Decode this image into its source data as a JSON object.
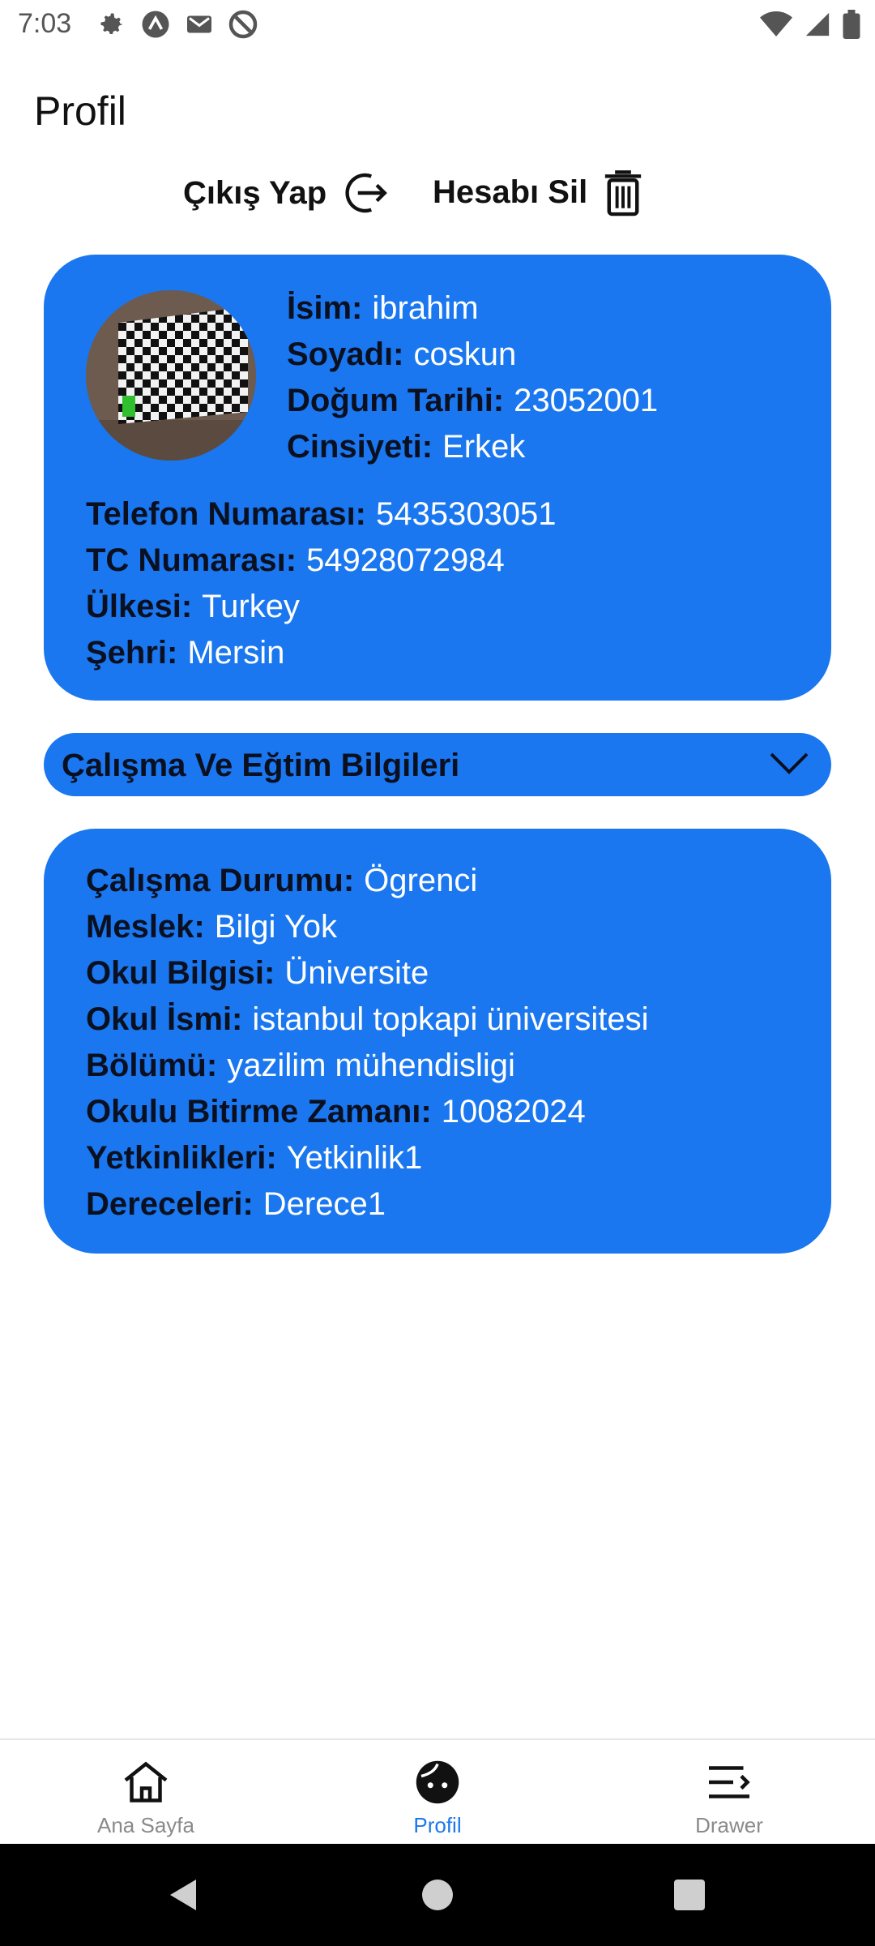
{
  "status_bar": {
    "time": "7:03",
    "icons_left": [
      "gear-icon",
      "app-icon",
      "gmail-icon",
      "nodisturb-icon"
    ],
    "icons_right": [
      "wifi-icon",
      "signal-icon",
      "battery-icon"
    ]
  },
  "header": {
    "title": "Profil"
  },
  "actions": {
    "logout_label": "Çıkış Yap",
    "delete_label": "Hesabı Sil"
  },
  "profile": {
    "fields": [
      {
        "key": "İsim:",
        "value": "ibrahim"
      },
      {
        "key": "Soyadı:",
        "value": "coskun"
      },
      {
        "key": "Doğum Tarihi:",
        "value": "23052001"
      },
      {
        "key": "Cinsiyeti:",
        "value": "Erkek"
      },
      {
        "key": "Telefon Numarası:",
        "value": "5435303051"
      },
      {
        "key": "TC Numarası:",
        "value": "54928072984"
      },
      {
        "key": "Ülkesi:",
        "value": "Turkey"
      },
      {
        "key": "Şehri:",
        "value": "Mersin"
      }
    ]
  },
  "accordion": {
    "title": "Çalışma Ve Eğtim Bilgileri",
    "expanded": true
  },
  "work": {
    "fields": [
      {
        "key": "Çalışma Durumu:",
        "value": "Ögrenci"
      },
      {
        "key": "Meslek:",
        "value": "Bilgi Yok"
      },
      {
        "key": "Okul Bilgisi:",
        "value": "Üniversite"
      },
      {
        "key": "Okul İsmi:",
        "value": "istanbul topkapi üniversitesi"
      },
      {
        "key": "Bölümü:",
        "value": "yazilim mühendisligi"
      },
      {
        "key": "Okulu Bitirme Zamanı:",
        "value": "10082024"
      },
      {
        "key": "Yetkinlikleri:",
        "value": "Yetkinlik1"
      },
      {
        "key": "Dereceleri:",
        "value": "Derece1"
      }
    ]
  },
  "bottom_nav": {
    "items": [
      {
        "label": "Ana Sayfa",
        "icon": "home-icon"
      },
      {
        "label": "Profil",
        "icon": "profile-face-icon",
        "active": true
      },
      {
        "label": "Drawer",
        "icon": "drawer-icon"
      }
    ]
  },
  "colors": {
    "accent": "#1a77ef",
    "text_dark": "#0b1020"
  }
}
